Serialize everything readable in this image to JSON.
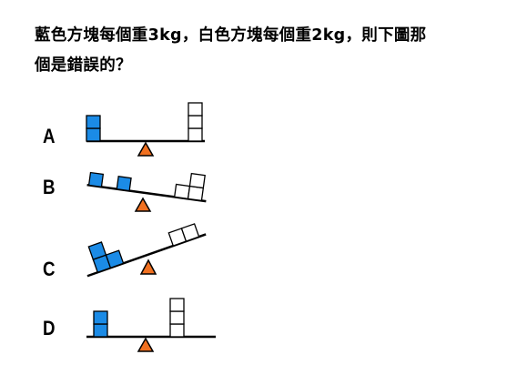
{
  "question": {
    "line1": "藍色方塊每個重3kg，白色方塊每個重2kg，則下圖那",
    "line2": "個是錯誤的？"
  },
  "options": [
    {
      "label": "A",
      "blue_blocks": 2,
      "white_blocks": 3,
      "tilt": "level"
    },
    {
      "label": "B",
      "blue_blocks": 2,
      "white_blocks": 3,
      "tilt": "right-down"
    },
    {
      "label": "C",
      "blue_blocks": 3,
      "white_blocks": 2,
      "tilt": "left-down"
    },
    {
      "label": "D",
      "blue_blocks": 2,
      "white_blocks": 3,
      "tilt": "level"
    }
  ],
  "colors": {
    "blue_block": "#1b8be6",
    "white_block": "#ffffff",
    "fulcrum": "#f07020",
    "outline": "#000000"
  }
}
